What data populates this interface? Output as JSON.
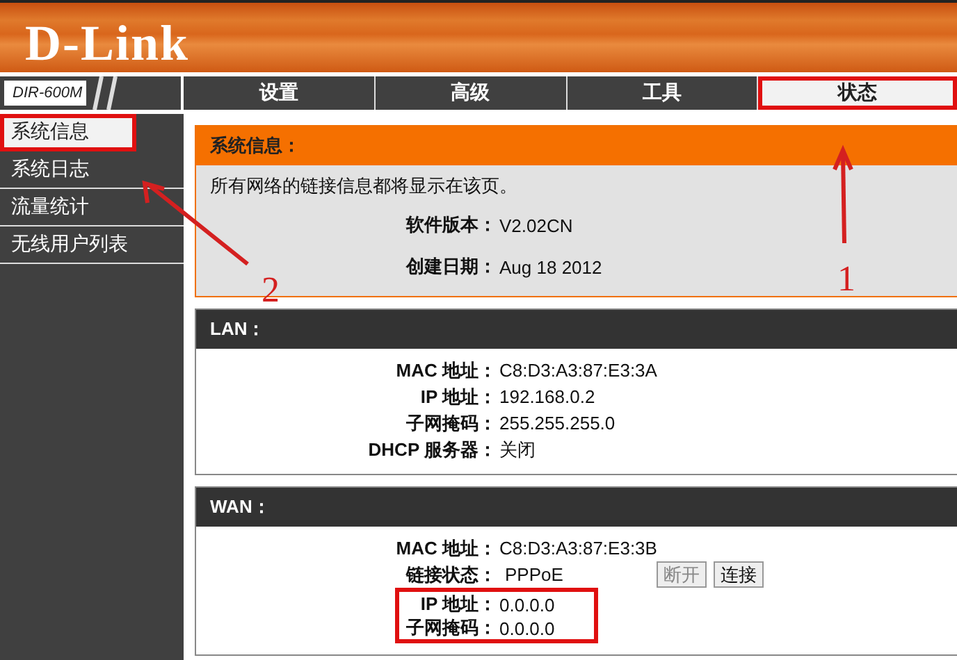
{
  "header": {
    "logo": "D-Link"
  },
  "nav": {
    "model": "DIR-600M",
    "tabs": [
      {
        "label": "设置",
        "selected": false,
        "highlighted": false
      },
      {
        "label": "高级",
        "selected": false,
        "highlighted": false
      },
      {
        "label": "工具",
        "selected": false,
        "highlighted": false
      },
      {
        "label": "状态",
        "selected": true,
        "highlighted": true
      }
    ]
  },
  "sidebar": {
    "items": [
      {
        "label": "系统信息",
        "selected": true,
        "highlighted": true
      },
      {
        "label": "系统日志",
        "selected": false,
        "highlighted": false
      },
      {
        "label": "流量统计",
        "selected": false,
        "highlighted": false
      },
      {
        "label": "无线用户列表",
        "selected": false,
        "highlighted": false
      }
    ]
  },
  "sections": [
    {
      "kind": "intro",
      "title": "系统信息：",
      "description": "所有网络的链接信息都将显示在该页。",
      "rows": [
        {
          "label": "软件版本：",
          "value": "V2.02CN",
          "highlighted": false
        },
        {
          "label": "创建日期：",
          "value": "Aug 18 2012",
          "highlighted": false
        }
      ]
    },
    {
      "kind": "info",
      "title": "LAN：",
      "rows": [
        {
          "label": "MAC 地址：",
          "value": "C8:D3:A3:87:E3:3A",
          "highlighted": false
        },
        {
          "label": "IP 地址：",
          "value": "192.168.0.2",
          "highlighted": false
        },
        {
          "label": "子网掩码：",
          "value": "255.255.255.0",
          "highlighted": false
        },
        {
          "label": "DHCP 服务器：",
          "value": "关闭",
          "highlighted": false
        }
      ]
    },
    {
      "kind": "info",
      "title": "WAN：",
      "rows": [
        {
          "label": "MAC 地址：",
          "value": "C8:D3:A3:87:E3:3B",
          "highlighted": false
        },
        {
          "label": "链接状态：",
          "value": "PPPoE",
          "highlighted": false,
          "buttons": [
            {
              "label": "断开",
              "disabled": true
            },
            {
              "label": "连接",
              "disabled": false
            }
          ]
        },
        {
          "label": "IP 地址：",
          "value": "0.0.0.0",
          "highlighted": true
        },
        {
          "label": "子网掩码：",
          "value": "0.0.0.0",
          "highlighted": true
        }
      ]
    }
  ],
  "annotations": [
    {
      "label": "1"
    },
    {
      "label": "2"
    }
  ]
}
